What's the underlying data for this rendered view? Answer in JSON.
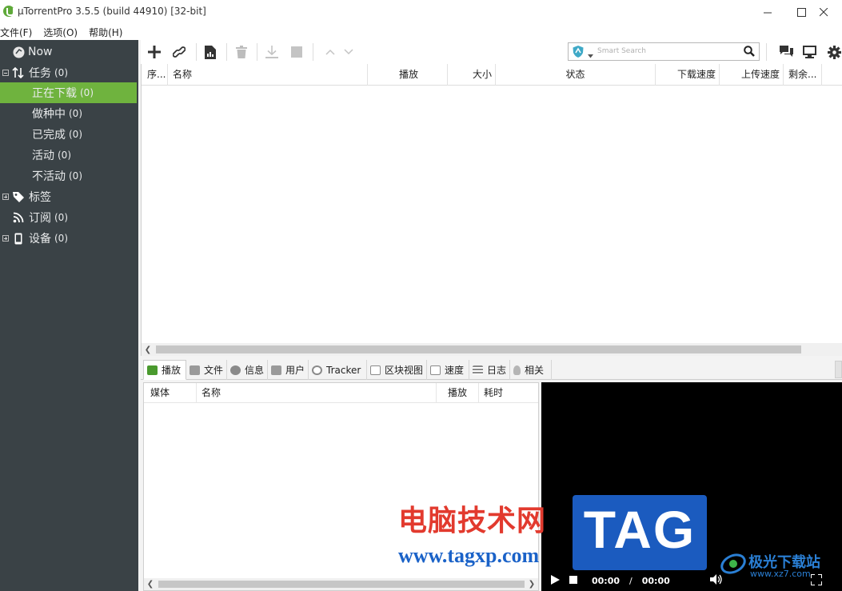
{
  "window": {
    "title": "µTorrentPro 3.5.5  (build 44910) [32-bit]",
    "minimize_icon": "minimize-icon",
    "maximize_icon": "maximize-icon",
    "close_icon": "close-icon"
  },
  "menu": [
    "文件(F)",
    "选项(O)",
    "帮助(H)"
  ],
  "sidebar": {
    "now_label": "Now",
    "tasks": {
      "label": "任务",
      "count": "(0)"
    },
    "sub_items": [
      {
        "label": "正在下载",
        "count": "(0)",
        "active": true
      },
      {
        "label": "做种中",
        "count": "(0)"
      },
      {
        "label": "已完成",
        "count": "(0)"
      },
      {
        "label": "活动",
        "count": "(0)"
      },
      {
        "label": "不活动",
        "count": "(0)"
      }
    ],
    "labels": {
      "label": "标签"
    },
    "feeds": {
      "label": "订阅",
      "count": "(0)"
    },
    "devices": {
      "label": "设备",
      "count": "(0)"
    },
    "active_color": "#6fb33e",
    "bg_color": "#3a4246"
  },
  "toolbar": {
    "search_placeholder": "Smart Search",
    "icons": [
      "add-torrent-icon",
      "add-url-icon",
      "create-torrent-icon",
      "remove-icon",
      "download-icon",
      "stop-icon",
      "move-up-icon",
      "move-down-icon",
      "chat-icon",
      "remote-icon",
      "settings-icon"
    ]
  },
  "torrent_list": {
    "columns": [
      "序...",
      "名称",
      "播放",
      "大小",
      "状态",
      "下载速度",
      "上传速度",
      "剩余..."
    ]
  },
  "detail_tabs": [
    "播放",
    "文件",
    "信息",
    "用户",
    "Tracker",
    "区块视图",
    "速度",
    "日志",
    "相关"
  ],
  "media_list": {
    "columns": [
      "媒体",
      "名称",
      "播放",
      "耗时"
    ]
  },
  "player": {
    "time_current": "00:00",
    "time_sep": "/",
    "time_total": "00:00"
  },
  "watermark": {
    "cn_text": "电脑技术网",
    "url_text": "www.tagxp.com",
    "tag_text": "TAG",
    "site_text": "极光下载站",
    "site_url": "www.xz7.com"
  }
}
